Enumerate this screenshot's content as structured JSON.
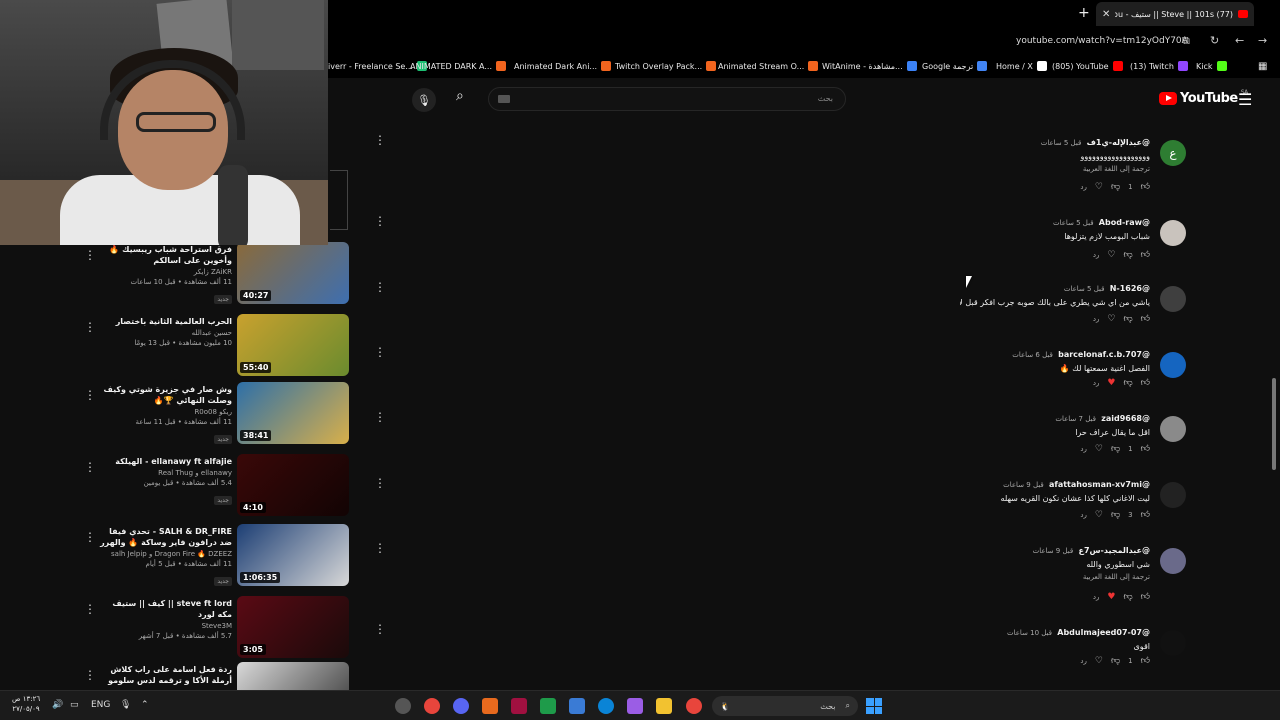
{
  "browser": {
    "tab_title": "(77) Steve || 101s || ستيف - You",
    "url": "youtube.com/watch?v=tm12yOdY70A",
    "bookmarks": [
      {
        "label": "iverr - Freelance Se...",
        "color": "#1dbf73"
      },
      {
        "label": "ANIMATED DARK A...",
        "color": "#f1641e"
      },
      {
        "label": "Animated Dark Ani...",
        "color": "#f1641e"
      },
      {
        "label": "Twitch Overlay Pack...",
        "color": "#f1641e"
      },
      {
        "label": "Animated Stream O...",
        "color": "#f1641e"
      },
      {
        "label": "WitAnime - مشاهدة...",
        "color": "#3b82f6"
      },
      {
        "label": "Google ترجمة",
        "color": "#4285f4"
      },
      {
        "label": "Home / X",
        "color": "#ffffff"
      },
      {
        "label": "(805) YouTube",
        "color": "#ff0000"
      },
      {
        "label": "(13) Twitch",
        "color": "#9146ff"
      },
      {
        "label": "Kick",
        "color": "#53fc18"
      }
    ]
  },
  "youtube": {
    "logo_text": "YouTube",
    "region": "SA",
    "search_placeholder": "بحث"
  },
  "recommendations": [
    {
      "title": "فرق استراحة شباب ريبسيك 🔥 وأخوين على اسالكم",
      "channel": "ZAiKR زايكر",
      "stats": "11 ألف مشاهدة • قبل 10 ساعات",
      "badge": "جديد",
      "duration": "40:27",
      "thumb": [
        "#8a6a3a",
        "#3e6fb0"
      ]
    },
    {
      "title": "الحرب العالمية الثانية باختصار",
      "channel": "حسين عبدالله",
      "stats": "10 مليون مشاهدة • قبل 13 يومًا",
      "badge": "",
      "duration": "55:40",
      "thumb": [
        "#c9a12e",
        "#6a8b2e"
      ]
    },
    {
      "title": "وش صار في جزيرة شوتي وكيف وصلت النهائي 🏆🔥",
      "channel": "ريكو R0o08",
      "stats": "11 ألف مشاهدة • قبل 11 ساعة",
      "badge": "جديد",
      "duration": "38:41",
      "thumb": [
        "#2d6fa8",
        "#d9b04a"
      ]
    },
    {
      "title": "ellanawy ft alfajie - الهيلكة",
      "channel": "ellanawy و Real Thug",
      "stats": "5.4 ألف مشاهدة • قبل يومين",
      "badge": "جديد",
      "duration": "4:10",
      "thumb": [
        "#3a0808",
        "#120404"
      ]
    },
    {
      "title": "SALH & DR_FIRE - تحدي فيفا ضد درافون فاير وساكة 🔥 والهرر",
      "channel": "Dragon Fire 🔥 DZEEZ و salh Jelpip",
      "stats": "11 ألف مشاهدة • قبل 5 أيام",
      "badge": "جديد",
      "duration": "1:06:35",
      "thumb": [
        "#1c3e74",
        "#d8d8d8"
      ]
    },
    {
      "title": "steve ft lord || كيف || ستيف مكه لورد",
      "channel": "Steve3M",
      "stats": "5.7 ألف مشاهدة • قبل 7 أشهر",
      "badge": "",
      "duration": "3:05",
      "thumb": [
        "#5a0a14",
        "#1a0a0a"
      ]
    },
    {
      "title": "ردة فعل اسامة على راب كلاش أرملة الأكا و ترقمه لدس سلومو القدم || samah...",
      "channel": "",
      "stats": "",
      "badge": "",
      "duration": "",
      "thumb": [
        "#d9d9d9",
        "#333333"
      ]
    }
  ],
  "comments": [
    {
      "author": "@عبدالإله-ي1ف",
      "time": "قبل 5 ساعات",
      "text": "ﻭﻭﻭﻭﻭﻭﻭﻭﻭﻭﻭﻭﻭﻭﻭﻭﻭﻭ",
      "translate": "ترجمة إلى اللغة العربية",
      "likes": "1",
      "avatar_text": "ع",
      "avatar_color": "#2e7d32",
      "hearted": false
    },
    {
      "author": "@Abod-raw",
      "time": "قبل 5 ساعات",
      "text": "شباب البومب لازم يتزلوها",
      "translate": "",
      "likes": "",
      "avatar_text": "",
      "avatar_color": "#c9c3bd",
      "hearted": false
    },
    {
      "author": "@N-1626",
      "time": "قبل 5 ساعات",
      "text": "ياشي من اي شي يطري على بالك صوبه جرب افكر قبل لا تتفذ",
      "translate": "",
      "likes": "",
      "avatar_text": "",
      "avatar_color": "#3f3f3f",
      "hearted": false
    },
    {
      "author": "@barcelonaf.c.b.707",
      "time": "قبل 6 ساعات",
      "text": "الفصل اغنية سمعتها لك 🔥",
      "translate": "",
      "likes": "",
      "avatar_text": "",
      "avatar_color": "#1565c0",
      "hearted": true
    },
    {
      "author": "@zaid9668",
      "time": "قبل 7 ساعات",
      "text": "اقل ما يقال عراف حرا",
      "translate": "",
      "likes": "1",
      "avatar_text": "",
      "avatar_color": "#8a8a8a",
      "hearted": false
    },
    {
      "author": "@afattahosman-xv7mi",
      "time": "قبل 9 ساعات",
      "text": "ليت الاغاني كلها كذا عشان نكون القريه سهله",
      "translate": "",
      "likes": "3",
      "avatar_text": "",
      "avatar_color": "#222222",
      "hearted": false
    },
    {
      "author": "@عبدالمجيد-س7ع",
      "time": "قبل 9 ساعات",
      "text": "شي اسطوري والله",
      "translate": "ترجمة إلى اللغة العربية",
      "likes": "",
      "avatar_text": "",
      "avatar_color": "#6a6a8a",
      "hearted": true
    },
    {
      "author": "@Abdulmajeed07-07",
      "time": "قبل 10 ساعات",
      "text": "اقوى",
      "translate": "",
      "likes": "1",
      "avatar_text": "",
      "avatar_color": "#111111",
      "hearted": false
    }
  ],
  "comment_reply_label": "رد",
  "taskbar": {
    "time": "١٣:٢٦ ص",
    "date": "٢٧/٠٥/٠٩",
    "language": "ENG",
    "search_label": "بحث"
  }
}
